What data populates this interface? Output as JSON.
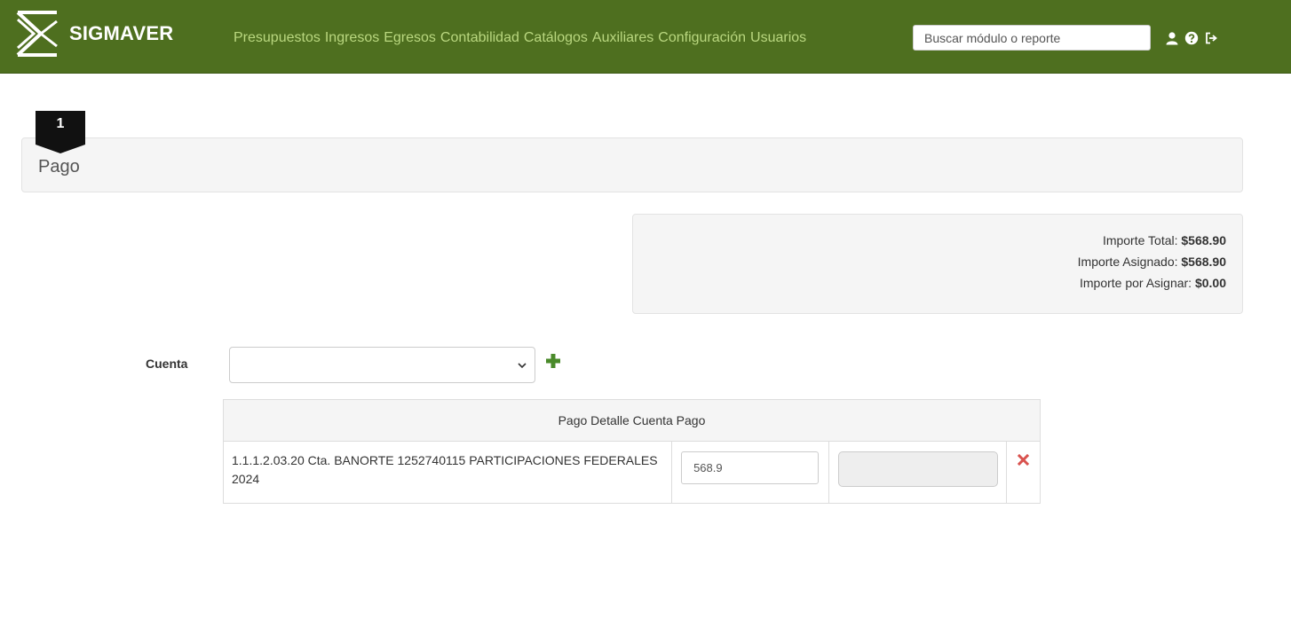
{
  "app": {
    "brand": "SIGMAVER",
    "brand_color": "#4e6f1f",
    "link_color": "#b9d77f"
  },
  "nav": {
    "items": [
      {
        "label": "Presupuestos"
      },
      {
        "label": "Ingresos"
      },
      {
        "label": "Egresos"
      },
      {
        "label": "Contabilidad"
      },
      {
        "label": "Catálogos"
      },
      {
        "label": "Auxiliares"
      },
      {
        "label": "Configuración"
      },
      {
        "label": "Usuarios"
      }
    ],
    "search_placeholder": "Buscar módulo o reporte",
    "icons": [
      "user-icon",
      "help-icon",
      "logout-icon"
    ]
  },
  "step": {
    "number": "1",
    "title": "Pago"
  },
  "totals": {
    "total_label": "Importe Total:",
    "total_value": "$568.90",
    "assigned_label": "Importe Asignado:",
    "assigned_value": "$568.90",
    "pending_label": "Importe por Asignar:",
    "pending_value": "$0.00"
  },
  "cuenta": {
    "label": "Cuenta",
    "selected": "",
    "add_icon": "plus-icon",
    "add_color": "#4a8a2a"
  },
  "detail_table": {
    "header": "Pago Detalle Cuenta Pago",
    "rows": [
      {
        "account": "1.1.1.2.03.20 Cta. BANORTE 1252740115 PARTICIPACIONES FEDERALES 2024",
        "amount": "568.9",
        "remove_icon": "remove-icon",
        "remove_color": "#d9534f"
      }
    ]
  }
}
